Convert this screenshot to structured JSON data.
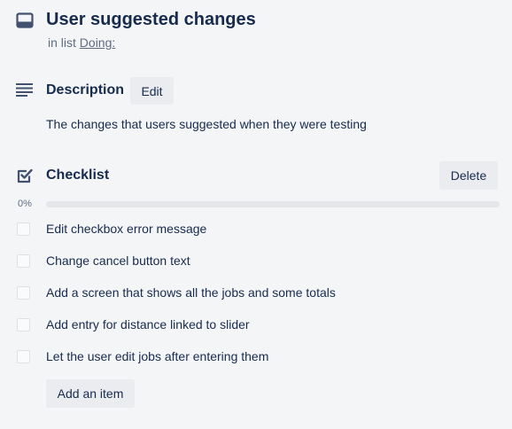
{
  "card": {
    "title": "User suggested changes",
    "in_list_prefix": "in list",
    "list_name": "Doing:",
    "icon": "card-icon"
  },
  "description": {
    "heading": "Description",
    "edit_label": "Edit",
    "text": "The changes that users suggested when they were testing",
    "icon": "description-lines-icon"
  },
  "checklist": {
    "heading": "Checklist",
    "delete_label": "Delete",
    "progress_label": "0%",
    "progress": 0,
    "icon": "checkbox-check-icon",
    "items": [
      {
        "label": "Edit checkbox error message",
        "checked": false
      },
      {
        "label": "Change cancel button text",
        "checked": false
      },
      {
        "label": "Add a screen that shows all the jobs and some totals",
        "checked": false
      },
      {
        "label": "Add entry for distance linked to slider",
        "checked": false
      },
      {
        "label": "Let the user edit jobs after entering them",
        "checked": false
      }
    ],
    "add_item_label": "Add an item"
  },
  "colors": {
    "background": "#f4f5f7",
    "text": "#172b4d",
    "muted": "#5e6c84",
    "button": "#ebecf0",
    "progress_track": "#e4e6ea",
    "progress_fill": "#5ba4cf"
  }
}
